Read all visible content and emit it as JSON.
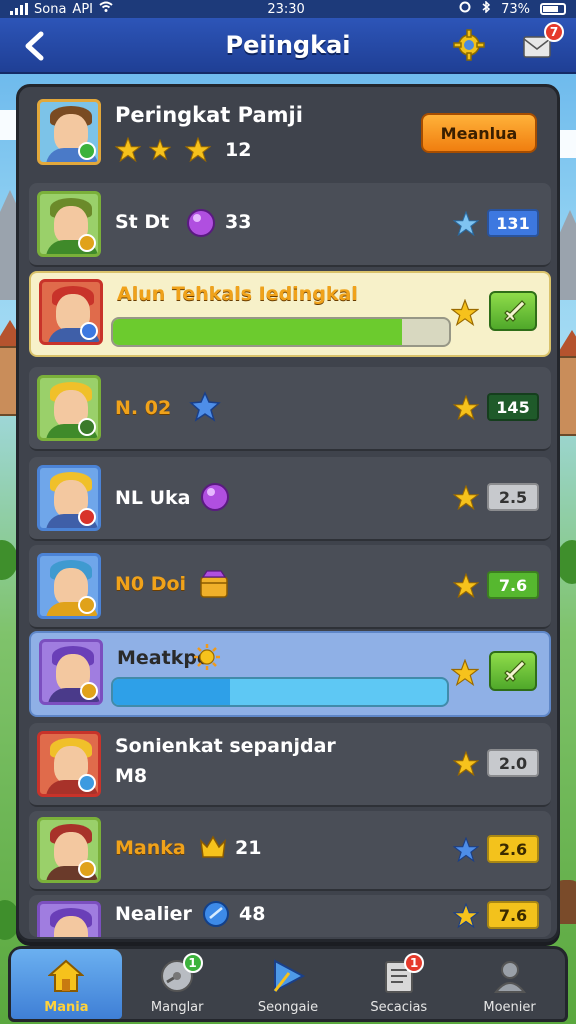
{
  "status_bar": {
    "left_text": "Sona",
    "carrier": "API",
    "time": "23:30",
    "battery": "73%"
  },
  "header": {
    "title": "Peiingkai",
    "notification_badge": "7"
  },
  "leaderboard": {
    "top": {
      "name": "Peringkat Pamji",
      "stars": 3,
      "score": "12",
      "button_label": "Meanlua"
    },
    "rows": [
      {
        "name": "St   Dt",
        "item_value": "33",
        "score": "131",
        "score_style": "blue"
      },
      {
        "name": "Alun Tehkals Iedingkal",
        "progress": 0.86,
        "progress_color": "#6ccb2e",
        "action": "sword"
      },
      {
        "name": "N.   02",
        "score": "145",
        "score_style": "dkgreen"
      },
      {
        "name": "NL   Uka",
        "score": "2.5",
        "score_style": "grey"
      },
      {
        "name": "N0   Doi",
        "score": "7.6",
        "score_style": "green"
      },
      {
        "name": "Meatkpe",
        "progress": 0.35,
        "progress_color": "#44b8f0",
        "action": "sword"
      },
      {
        "name": "Sonienkat sepanjdar",
        "subtitle": "M8",
        "score": "2.0",
        "score_style": "grey"
      },
      {
        "name": "Manka",
        "item_value": "21",
        "score": "2.6",
        "score_style": "yellow"
      },
      {
        "name": "Nealier",
        "item_value": "48",
        "score": "7.6",
        "score_style": "yellow"
      }
    ]
  },
  "bottom_nav": {
    "items": [
      {
        "label": "Mania",
        "icon": "home-icon",
        "active": true
      },
      {
        "label": "Manglar",
        "icon": "disc-icon",
        "badge": "1"
      },
      {
        "label": "Seongaie",
        "icon": "play-icon"
      },
      {
        "label": "Secacias",
        "icon": "notes-icon",
        "badge": "1"
      },
      {
        "label": "Moenier",
        "icon": "profile-icon"
      }
    ]
  },
  "colors": {
    "header": "#2d55b8",
    "panel": "#3f434c",
    "accent_orange": "#f07e0f",
    "accent_green": "#56b82f"
  }
}
